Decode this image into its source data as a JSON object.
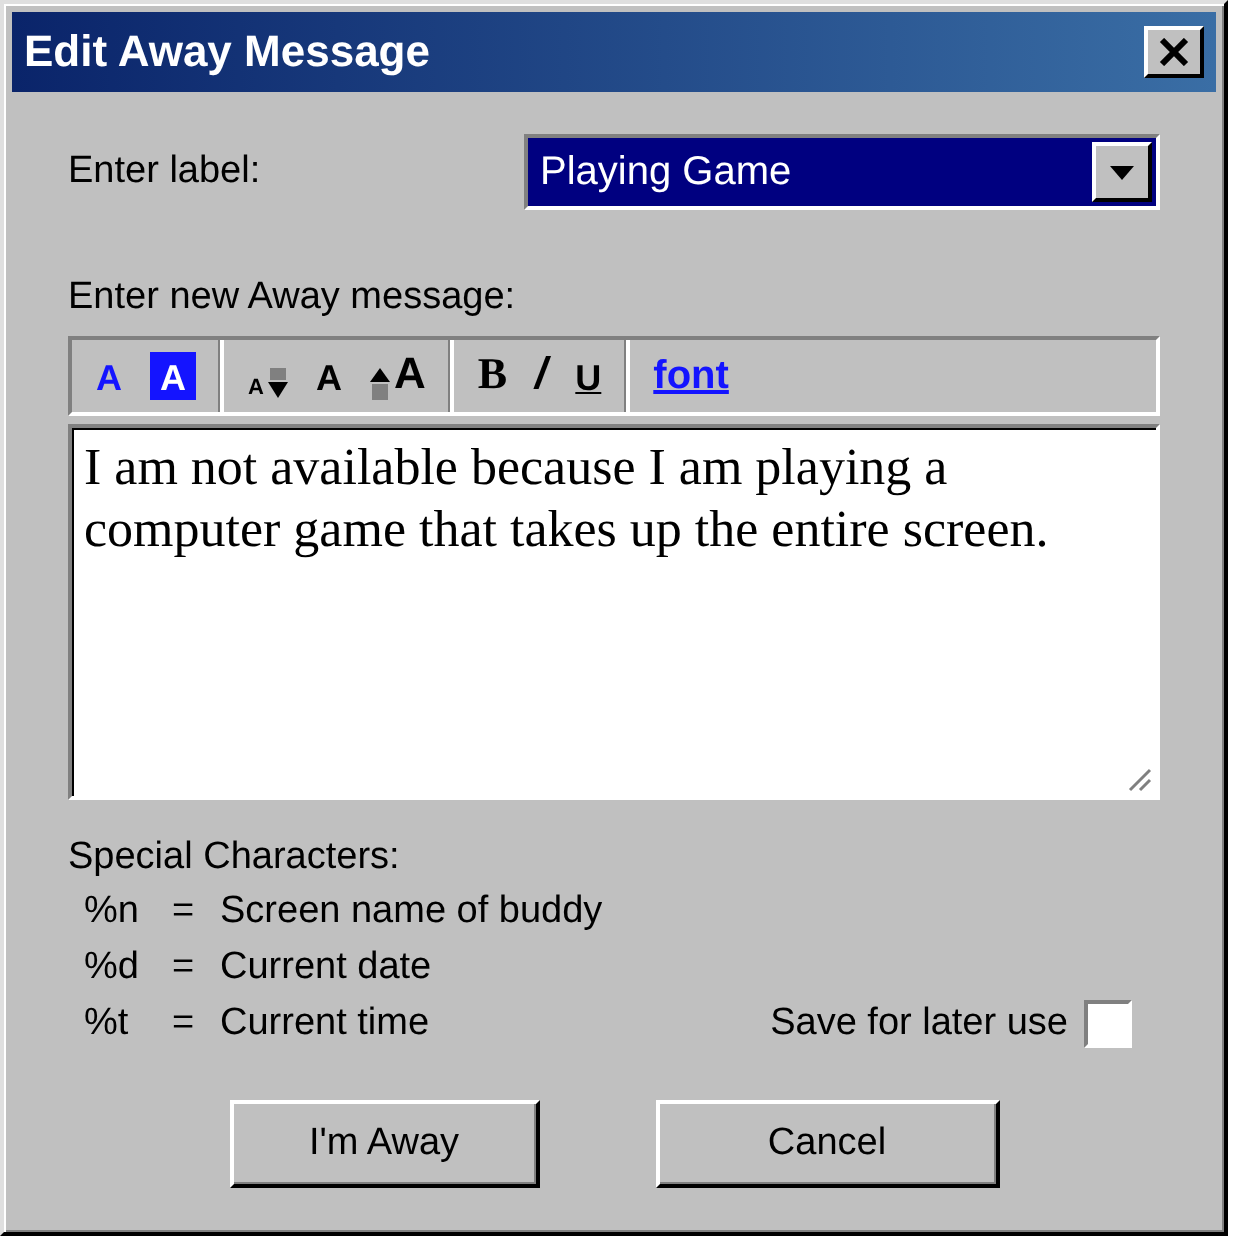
{
  "window": {
    "title": "Edit Away Message"
  },
  "label_field": {
    "label": "Enter label:",
    "value": "Playing Game"
  },
  "message_label": "Enter new Away message:",
  "toolbar": [
    [
      {
        "kind": "text-color",
        "glyph": "A"
      },
      {
        "kind": "back-color",
        "glyph": "A"
      }
    ],
    [
      {
        "kind": "smaller",
        "glyph": "A"
      },
      {
        "kind": "normal",
        "glyph": "A"
      },
      {
        "kind": "larger",
        "glyph": "A"
      }
    ],
    [
      {
        "kind": "bold",
        "glyph": "B"
      },
      {
        "kind": "italic",
        "glyph": "/"
      },
      {
        "kind": "underline",
        "glyph": "U"
      }
    ],
    [
      {
        "kind": "link",
        "glyph": "font"
      }
    ]
  ],
  "message": "I am not available because I am playing a computer game that takes up the entire screen.",
  "special": {
    "title": "Special Characters:",
    "items": [
      {
        "code": "%n",
        "eq": "=",
        "meaning": "Screen name of buddy"
      },
      {
        "code": "%d",
        "eq": "=",
        "meaning": "Current date"
      },
      {
        "code": "%t",
        "eq": "=",
        "meaning": "Current time"
      }
    ]
  },
  "save": {
    "label": "Save for later use",
    "checked": false
  },
  "buttons": [
    "I'm Away",
    "Cancel"
  ]
}
